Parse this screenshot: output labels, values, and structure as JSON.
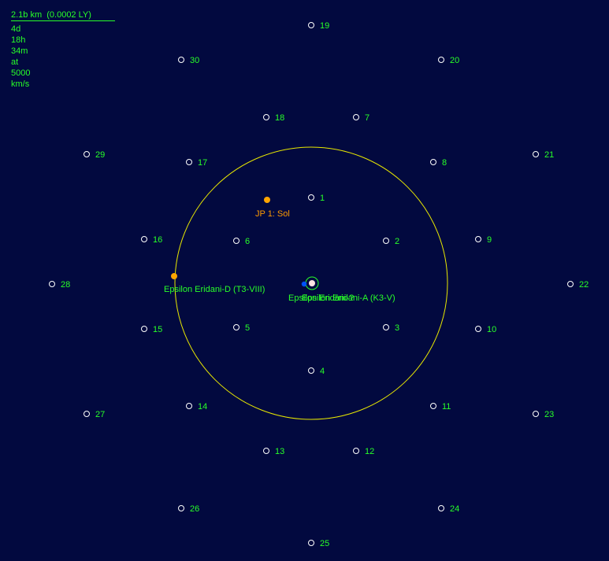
{
  "scale": {
    "distance": "2.1b km  (0.0002 LY)",
    "travel_time": "4d 18h 34m at 5000 km/s"
  },
  "colors": {
    "background": "#02093f",
    "orbit": "#e8e800",
    "label_green": "#28ff28",
    "label_orange": "#ff9a00",
    "node": "#ffffff",
    "planet": "#ffa500",
    "star": "#ffe3e3",
    "companion": "#0050ff"
  },
  "bodies": [
    {
      "name": "Epsilon Eridani-A (K3-V)",
      "type": "star"
    },
    {
      "name": "Epsilon Eridani-?",
      "type": "companion-star"
    },
    {
      "name": "Epsilon Eridani-D (T3-VIII)",
      "type": "planet"
    },
    {
      "name": "JP 1: Sol",
      "type": "jump-point"
    }
  ],
  "waypoints": [
    {
      "label": "1"
    },
    {
      "label": "2"
    },
    {
      "label": "3"
    },
    {
      "label": "4"
    },
    {
      "label": "5"
    },
    {
      "label": "6"
    },
    {
      "label": "7"
    },
    {
      "label": "8"
    },
    {
      "label": "9"
    },
    {
      "label": "10"
    },
    {
      "label": "11"
    },
    {
      "label": "12"
    },
    {
      "label": "13"
    },
    {
      "label": "14"
    },
    {
      "label": "15"
    },
    {
      "label": "16"
    },
    {
      "label": "17"
    },
    {
      "label": "18"
    },
    {
      "label": "19"
    },
    {
      "label": "20"
    },
    {
      "label": "21"
    },
    {
      "label": "22"
    },
    {
      "label": "23"
    },
    {
      "label": "24"
    },
    {
      "label": "25"
    },
    {
      "label": "26"
    },
    {
      "label": "27"
    },
    {
      "label": "28"
    },
    {
      "label": "29"
    },
    {
      "label": "30"
    }
  ]
}
